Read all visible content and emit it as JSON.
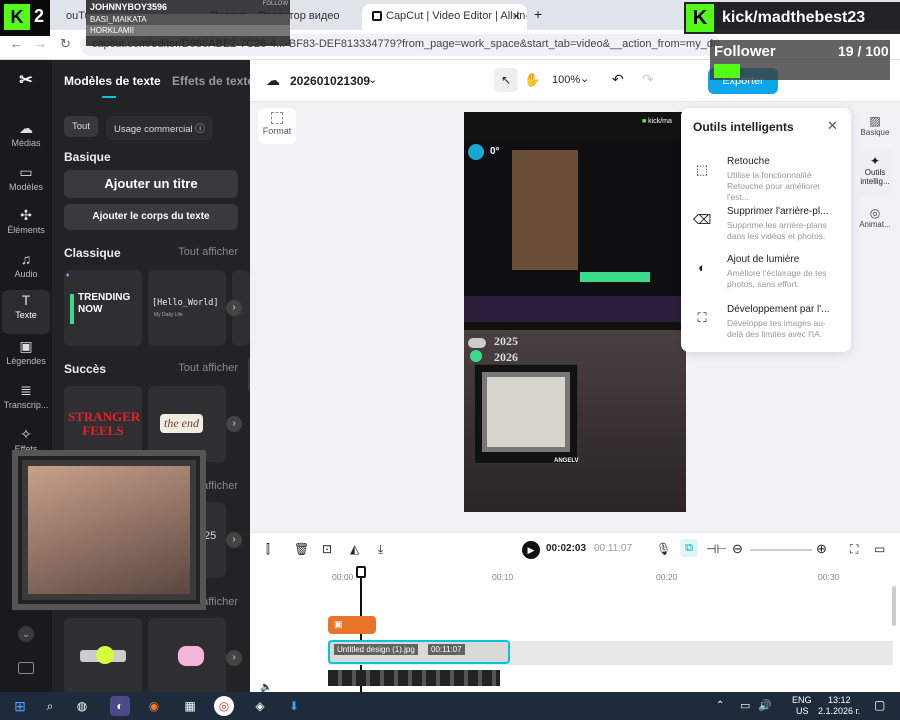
{
  "browser": {
    "tabs": [
      "ouTube",
      "Проект – Редактор видео",
      "CapCut | Video Editor | All-In-O"
    ],
    "url": "capcut.com/editor/D986ABE2-7C26-4...-BF83-DEF813334779?from_page=work_space&start_tab=video&__action_from=my_draft&positi"
  },
  "overlay": {
    "kick_logo": "K",
    "kick_num": "2",
    "names": [
      "JOHNNYBOY3596",
      "BASI_MAIKATA",
      "HORKLAMII"
    ],
    "follow": "FOLLOW",
    "channel": "kick/madthebest23",
    "follower_label": "Follower",
    "follower_count": "19 / 100"
  },
  "rail": [
    {
      "icon": "media-icon",
      "label": "Médias"
    },
    {
      "icon": "models-icon",
      "label": "Modèles"
    },
    {
      "icon": "elements-icon",
      "label": "Éléments"
    },
    {
      "icon": "audio-icon",
      "label": "Audio"
    },
    {
      "icon": "text-icon",
      "label": "Texte"
    },
    {
      "icon": "captions-icon",
      "label": "Légendes"
    },
    {
      "icon": "transcript-icon",
      "label": "Transcrip..."
    },
    {
      "icon": "effects-icon",
      "label": "Effets"
    }
  ],
  "panel": {
    "tab1": "Modèles de texte",
    "tab2": "Effets de texte",
    "filter_all": "Tout",
    "filter_commercial": "Usage commercial",
    "basic_title": "Basique",
    "add_title": "Ajouter un titre",
    "add_body": "Ajouter le corps du texte",
    "classic_title": "Classique",
    "show_all": "Tout afficher",
    "card_trending": "TRENDING NOW",
    "card_hello": "[Hello_World]",
    "card_hello_sub": "My Daily Life",
    "success_title": "Succès",
    "card_stranger": "STRANGER FEELS",
    "card_end": "the end",
    "card_25": "25"
  },
  "topbar": {
    "project": "202601021309",
    "zoom": "100%",
    "export": "Exporter"
  },
  "format_label": "Format",
  "preview": {
    "deg": "0°",
    "year1": "2025",
    "year2": "2026",
    "angel": "ANGELV"
  },
  "smart": {
    "title": "Outils intelligents",
    "tools": [
      {
        "name": "Retouche",
        "desc": "Utilise la fonctionnalité Retouche pour améliorer l'est..."
      },
      {
        "name": "Supprimer l'arrière-pl...",
        "desc": "Supprime les arrière-plans dans les vidéos et photos."
      },
      {
        "name": "Ajout de lumière",
        "desc": "Améliore l'éclairage de tes photos, sans effort."
      },
      {
        "name": "Développement par l'...",
        "desc": "Développe tes images au-delà des limites avec l'IA."
      }
    ]
  },
  "rtabs": [
    "Basique",
    "Outils intellig...",
    "Animat..."
  ],
  "timeline": {
    "current": "00:02:03",
    "total": "00:11:07",
    "ticks": [
      "00:00",
      "00:10",
      "00:20",
      "00:30"
    ],
    "clip_name": "Untitled design (1).jpg",
    "clip_dur": "00:11:07"
  },
  "taskbar": {
    "lang1": "ENG",
    "lang2": "US",
    "time": "13:12",
    "date": "2.1.2026 г."
  },
  "colors": {
    "accent": "#00c7d6",
    "kick_green": "#53fc18",
    "clip_orange": "#e8742a"
  }
}
